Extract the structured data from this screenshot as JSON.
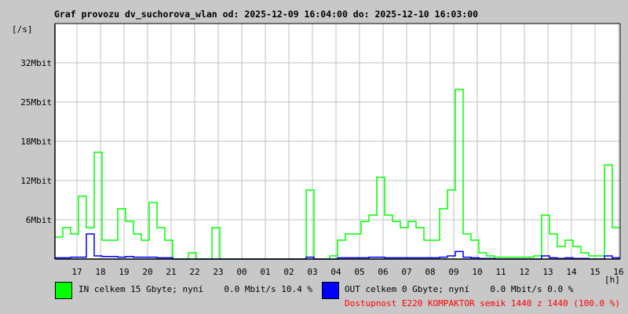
{
  "title": "Graf provozu dv_suchorova_wlan od: 2025-12-09 16:04:00 do: 2025-12-10 16:03:00",
  "chart_data": {
    "type": "line",
    "title": "Graf provozu dv_suchorova_wlan od: 2025-12-09 16:04:00 do: 2025-12-10 16:03:00",
    "ylabel": "[/s]",
    "xlabel": "[h]",
    "ylim": [
      0,
      37.5
    ],
    "y_unit": "Mbit",
    "y_ticks": [
      6.25,
      12.5,
      18.75,
      25,
      31.25
    ],
    "y_tick_labels": [
      "6Mbit",
      "12Mbit",
      "18Mbit",
      "25Mbit",
      "32Mbit"
    ],
    "x_start": "2025-12-09 16:04",
    "x_end": "2025-12-10 16:04",
    "x_step_minutes": 20,
    "x_tick_labels": [
      "17",
      "18",
      "19",
      "20",
      "21",
      "22",
      "23",
      "00",
      "01",
      "02",
      "03",
      "04",
      "05",
      "06",
      "07",
      "08",
      "09",
      "10",
      "11",
      "12",
      "13",
      "14",
      "15",
      "16"
    ],
    "grid": true,
    "series": [
      {
        "name": "IN",
        "color": "#00ff00",
        "values": [
          3.5,
          5,
          4,
          10,
          5,
          17,
          3,
          3,
          8,
          6,
          4,
          3,
          9,
          5,
          3,
          0,
          0,
          1,
          0,
          0,
          5,
          0,
          0,
          0,
          0,
          0,
          0,
          0,
          0,
          0,
          0,
          0,
          11,
          0,
          0,
          0.5,
          3,
          4,
          4,
          6,
          7,
          13,
          7,
          6,
          5,
          6,
          5,
          3,
          3,
          8,
          11,
          27,
          4,
          3,
          1,
          0.5,
          0.3,
          0.3,
          0.3,
          0.3,
          0.3,
          0.5,
          7,
          4,
          2,
          3,
          2,
          1,
          0.5,
          0.5,
          15,
          5
        ]
      },
      {
        "name": "OUT",
        "color": "#0000ff",
        "values": [
          0.2,
          0.2,
          0.3,
          0.3,
          4,
          0.5,
          0.4,
          0.4,
          0.3,
          0.4,
          0.3,
          0.3,
          0.3,
          0.2,
          0.2,
          0,
          0,
          0,
          0,
          0,
          0,
          0,
          0,
          0,
          0,
          0,
          0,
          0,
          0,
          0,
          0,
          0,
          0.3,
          0,
          0,
          0,
          0.2,
          0.2,
          0.2,
          0.2,
          0.3,
          0.3,
          0.2,
          0.2,
          0.2,
          0.2,
          0.2,
          0.2,
          0.2,
          0.3,
          0.5,
          1.2,
          0.3,
          0.2,
          0.1,
          0.1,
          0,
          0,
          0,
          0,
          0,
          0,
          0.5,
          0.2,
          0.1,
          0.2,
          0.1,
          0.1,
          0,
          0,
          0.5,
          0.2
        ]
      }
    ]
  },
  "legend": {
    "in": {
      "color": "#00ff00",
      "text": "IN celkem 15 Gbyte; nyní    0.0 Mbit/s 10.4 %"
    },
    "out": {
      "color": "#0000ff",
      "text": "OUT celkem 0 Gbyte; nyní    0.0 Mbit/s 0.0 %"
    }
  },
  "availability": "Dostupnost E220 KOMPAKTOR semik 1440 z 1440 (100.0 %)"
}
